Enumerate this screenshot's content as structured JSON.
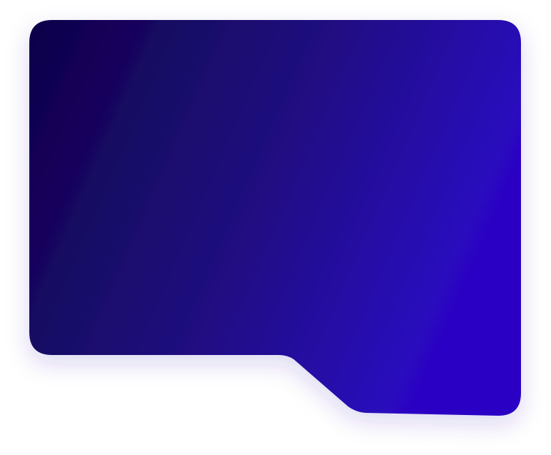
{
  "card": {
    "gradient_start": "#0e0049",
    "gradient_mid": "#201080",
    "gradient_end": "#2a06c4",
    "shadow_color": "#3c28b4"
  }
}
